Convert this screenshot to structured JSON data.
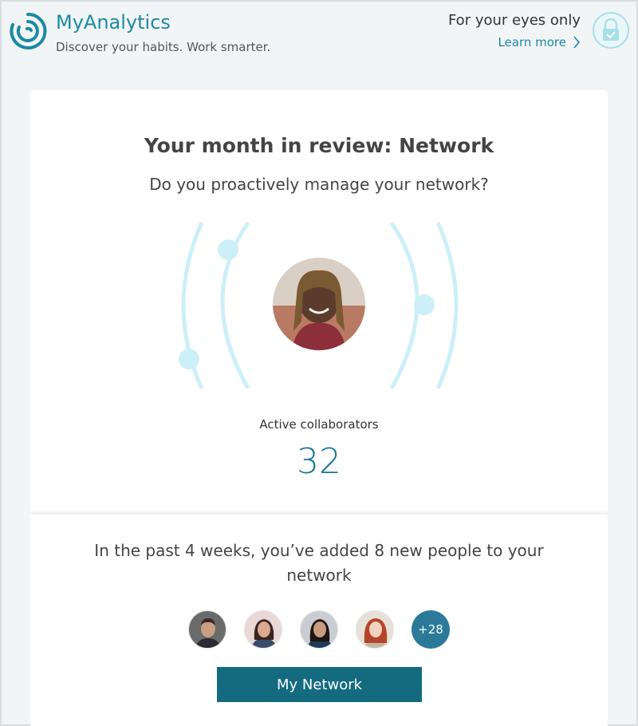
{
  "header": {
    "app_title": "MyAnalytics",
    "tagline": "Discover your habits. Work smarter.",
    "privacy_title": "For your eyes only",
    "learn_more": "Learn more",
    "accent_color": "#1b8aa3"
  },
  "card": {
    "title": "Your month in review: Network",
    "subtitle": "Do you proactively manage your network?",
    "metric_label": "Active collaborators",
    "metric_value": "32",
    "added_text": "In the past 4 weeks, you’ve added 8 new people to your network",
    "more_count": "+28",
    "button_label": "My Network",
    "button_color": "#146b80"
  },
  "icons": [
    "myanalytics-logo-icon",
    "lock-icon",
    "chevron-right-icon"
  ]
}
